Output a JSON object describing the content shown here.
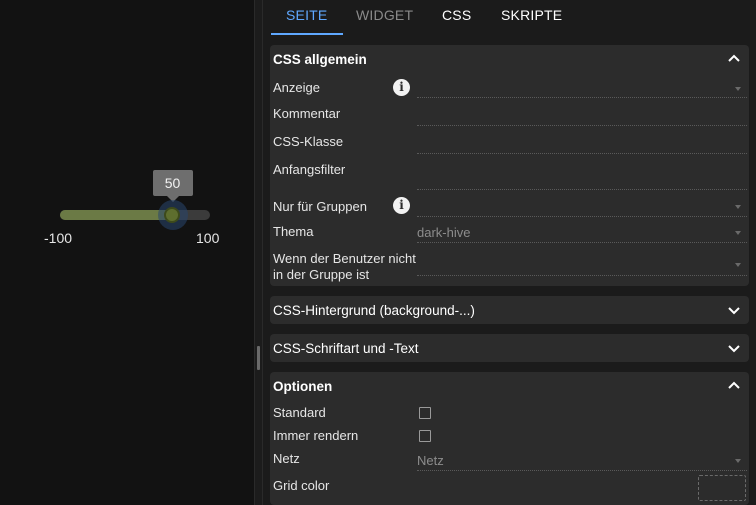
{
  "canvas": {
    "slider": {
      "value": 50,
      "min_label": "-100",
      "max_label": "100",
      "tooltip": "50",
      "fill_color": "#6b7a45",
      "thumb_color": "#5e6e2e"
    }
  },
  "tabs": [
    {
      "label": "SEITE",
      "active": true
    },
    {
      "label": "WIDGET",
      "active": false
    },
    {
      "label": "CSS",
      "active": false
    },
    {
      "label": "SKRIPTE",
      "active": false
    }
  ],
  "groups": {
    "css_general": {
      "title": "CSS allgemein",
      "expanded": true,
      "fields": {
        "anzeige": {
          "label": "Anzeige",
          "value": ""
        },
        "kommentar": {
          "label": "Kommentar",
          "value": ""
        },
        "css_klasse": {
          "label": "CSS-Klasse",
          "value": ""
        },
        "anfangsfilter": {
          "label": "Anfangsfilter",
          "value": ""
        },
        "nur_fuer_gruppen": {
          "label": "Nur für Gruppen",
          "value": ""
        },
        "thema": {
          "label": "Thema",
          "value": "dark-hive"
        },
        "wenn_benutzer": {
          "label_line1": "Wenn der Benutzer nicht",
          "label_line2": "in der Gruppe ist",
          "value": ""
        }
      }
    },
    "css_background": {
      "title": "CSS-Hintergrund (background-...)",
      "expanded": false
    },
    "css_font": {
      "title": "CSS-Schriftart und -Text",
      "expanded": false
    },
    "options": {
      "title": "Optionen",
      "expanded": true,
      "fields": {
        "standard": {
          "label": "Standard",
          "checked": false
        },
        "immer_rendern": {
          "label": "Immer rendern",
          "checked": false
        },
        "netz": {
          "label": "Netz",
          "value": "Netz"
        },
        "grid_color": {
          "label": "Grid color",
          "value": ""
        }
      }
    }
  },
  "colors": {
    "accent": "#5fa8ff",
    "panel_bg": "#1b1b1b",
    "group_bg": "#2c2c2c"
  }
}
